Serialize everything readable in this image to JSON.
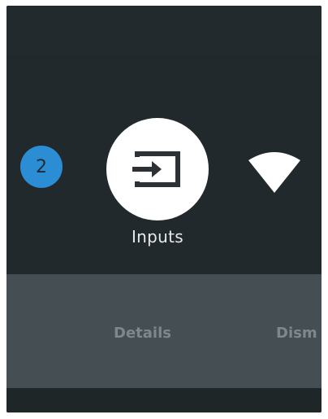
{
  "badge": {
    "count": "2"
  },
  "quick_settings": {
    "active": {
      "label": "Inputs",
      "icon": "input-source-icon"
    },
    "next": {
      "icon": "wifi-icon"
    }
  },
  "actions": {
    "details": "Details",
    "dismiss_partial": "Dism"
  },
  "colors": {
    "background": "#22292c",
    "badge": "#2b8ed4",
    "circle": "#ffffff",
    "actions_bar": "#454e52"
  }
}
